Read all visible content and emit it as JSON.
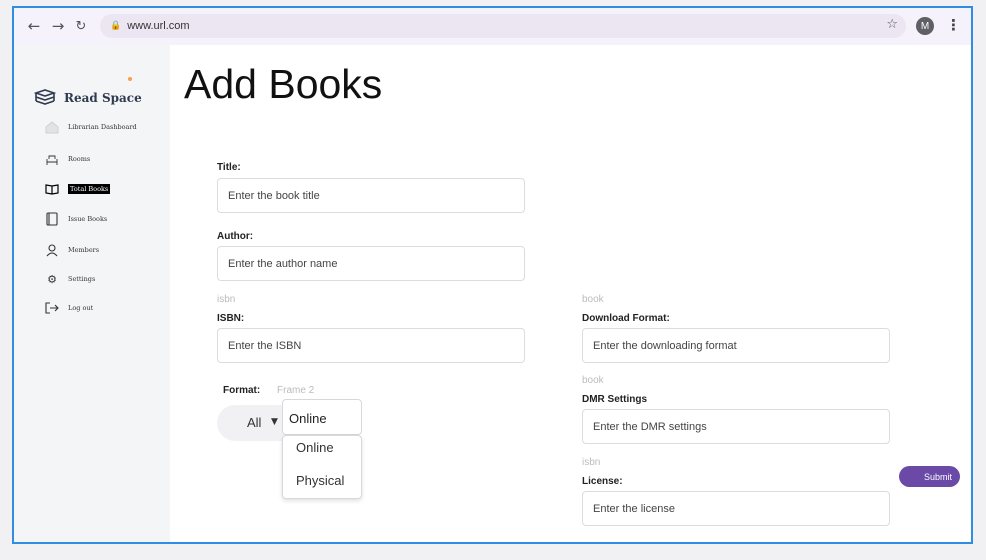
{
  "browser": {
    "url": "www.url.com",
    "avatar_initial": "M"
  },
  "sidebar": {
    "brand": "Read Space",
    "items": [
      {
        "label": "Librarian Dashboard",
        "icon": "home-icon"
      },
      {
        "label": "Rooms",
        "icon": "room-icon"
      },
      {
        "label": "Total Books",
        "icon": "open-book-icon",
        "active": true
      },
      {
        "label": "Issue Books",
        "icon": "book-icon"
      },
      {
        "label": "Members",
        "icon": "user-icon"
      },
      {
        "label": "Settings",
        "icon": "gear-icon"
      },
      {
        "label": "Log out",
        "icon": "logout-icon"
      }
    ]
  },
  "main": {
    "title": "Add Books",
    "fields": {
      "title": {
        "label": "Title:",
        "placeholder": "Enter the book title"
      },
      "author": {
        "label": "Author:",
        "placeholder": "Enter the author name"
      },
      "isbn": {
        "ghost": "isbn",
        "label": "ISBN:",
        "placeholder": "Enter the ISBN"
      },
      "download_format": {
        "ghost": "book",
        "label": "Download Format:",
        "placeholder": "Enter the downloading format"
      },
      "dmr_settings": {
        "ghost": "book",
        "label": "DMR Settings",
        "placeholder": "Enter the DMR settings"
      },
      "license": {
        "ghost": "isbn",
        "label": "License:",
        "placeholder": "Enter the license"
      }
    },
    "format": {
      "label": "Format:",
      "frame_label": "Frame 2",
      "value": "All",
      "selected": "Online",
      "options": [
        "Online",
        "Physical"
      ]
    },
    "submit_label": "Submit"
  },
  "colors": {
    "accent": "#6a4aa6",
    "frame_border": "#2f8de4",
    "brand_dot": "#f5a04a"
  }
}
